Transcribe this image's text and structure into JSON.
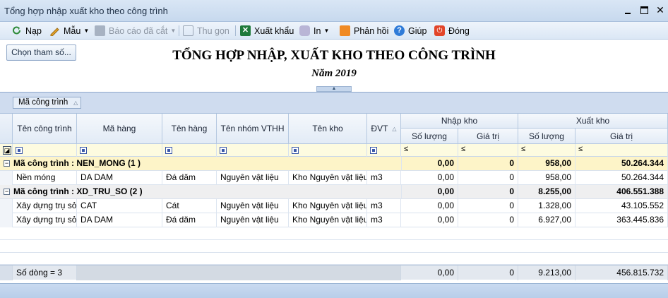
{
  "window": {
    "title": "Tổng hợp nhập xuất kho theo công trình"
  },
  "toolbar": {
    "nap": "Nạp",
    "mau": "Mẫu",
    "bao_cao_da_cat": "Báo cáo đã cắt",
    "thu_gon": "Thu gọn",
    "xuat_khau": "Xuất khẩu",
    "in": "In",
    "phan_hoi": "Phản hồi",
    "giup": "Giúp",
    "dong": "Đóng"
  },
  "header": {
    "choose_button": "Chọn tham số...",
    "title": "TỔNG HỢP NHẬP, XUẤT KHO THEO CÔNG TRÌNH",
    "subtitle": "Năm 2019"
  },
  "grid": {
    "group_chip": "Mã công trình",
    "columns": {
      "ten_cong_trinh": "Tên công trình",
      "ma_hang": "Mã hàng",
      "ten_hang": "Tên hàng",
      "ten_nhom": "Tên nhóm VTHH",
      "ten_kho": "Tên kho",
      "dvt": "ĐVT",
      "nhap_kho": "Nhập kho",
      "xuat_kho": "Xuất kho",
      "so_luong": "Số lượng",
      "gia_tri": "Giá trị"
    },
    "filter_le": "≤",
    "groups": [
      {
        "caption": "Mã công trình : NEN_MONG (1 )",
        "nhap_sl": "0,00",
        "nhap_gt": "0",
        "xuat_sl": "958,00",
        "xuat_gt": "50.264.344",
        "rows": [
          {
            "ten_cong_trinh": "Nền móng",
            "ma_hang": "DA DAM",
            "ten_hang": "Đá dăm",
            "ten_nhom": "Nguyên vật liệu",
            "ten_kho": "Kho Nguyên vật liệu",
            "dvt": "m3",
            "nhap_sl": "0,00",
            "nhap_gt": "0",
            "xuat_sl": "958,00",
            "xuat_gt": "50.264.344"
          }
        ]
      },
      {
        "caption": "Mã công trình : XD_TRU_SO (2 )",
        "nhap_sl": "0,00",
        "nhap_gt": "0",
        "xuat_sl": "8.255,00",
        "xuat_gt": "406.551.388",
        "rows": [
          {
            "ten_cong_trinh": "Xây dựng trụ sở",
            "ma_hang": "CAT",
            "ten_hang": "Cát",
            "ten_nhom": "Nguyên vật liệu",
            "ten_kho": "Kho Nguyên vật liệu",
            "dvt": "m3",
            "nhap_sl": "0,00",
            "nhap_gt": "0",
            "xuat_sl": "1.328,00",
            "xuat_gt": "43.105.552"
          },
          {
            "ten_cong_trinh": "Xây dựng trụ sở",
            "ma_hang": "DA DAM",
            "ten_hang": "Đá dăm",
            "ten_nhom": "Nguyên vật liệu",
            "ten_kho": "Kho Nguyên vật liệu",
            "dvt": "m3",
            "nhap_sl": "0,00",
            "nhap_gt": "0",
            "xuat_sl": "6.927,00",
            "xuat_gt": "363.445.836"
          }
        ]
      }
    ],
    "footer": {
      "so_dong": "Số dòng = 3",
      "nhap_sl": "0,00",
      "nhap_gt": "0",
      "xuat_sl": "9.213,00",
      "xuat_gt": "456.815.732"
    }
  },
  "icons": {
    "nap": "refresh-icon",
    "mau": "template-icon",
    "bao_cao": "save-icon",
    "thu_gon": "collapse-icon",
    "xuat_khau": "excel-icon",
    "in": "printer-icon",
    "phan_hoi": "mail-icon",
    "giup": "help-icon",
    "dong": "power-icon"
  },
  "colors": {
    "group1_bg": "#fdf4c8",
    "group2_bg": "#efeff0",
    "filter_bg": "#fdfbe0",
    "header_blue": "#cfdcef"
  }
}
